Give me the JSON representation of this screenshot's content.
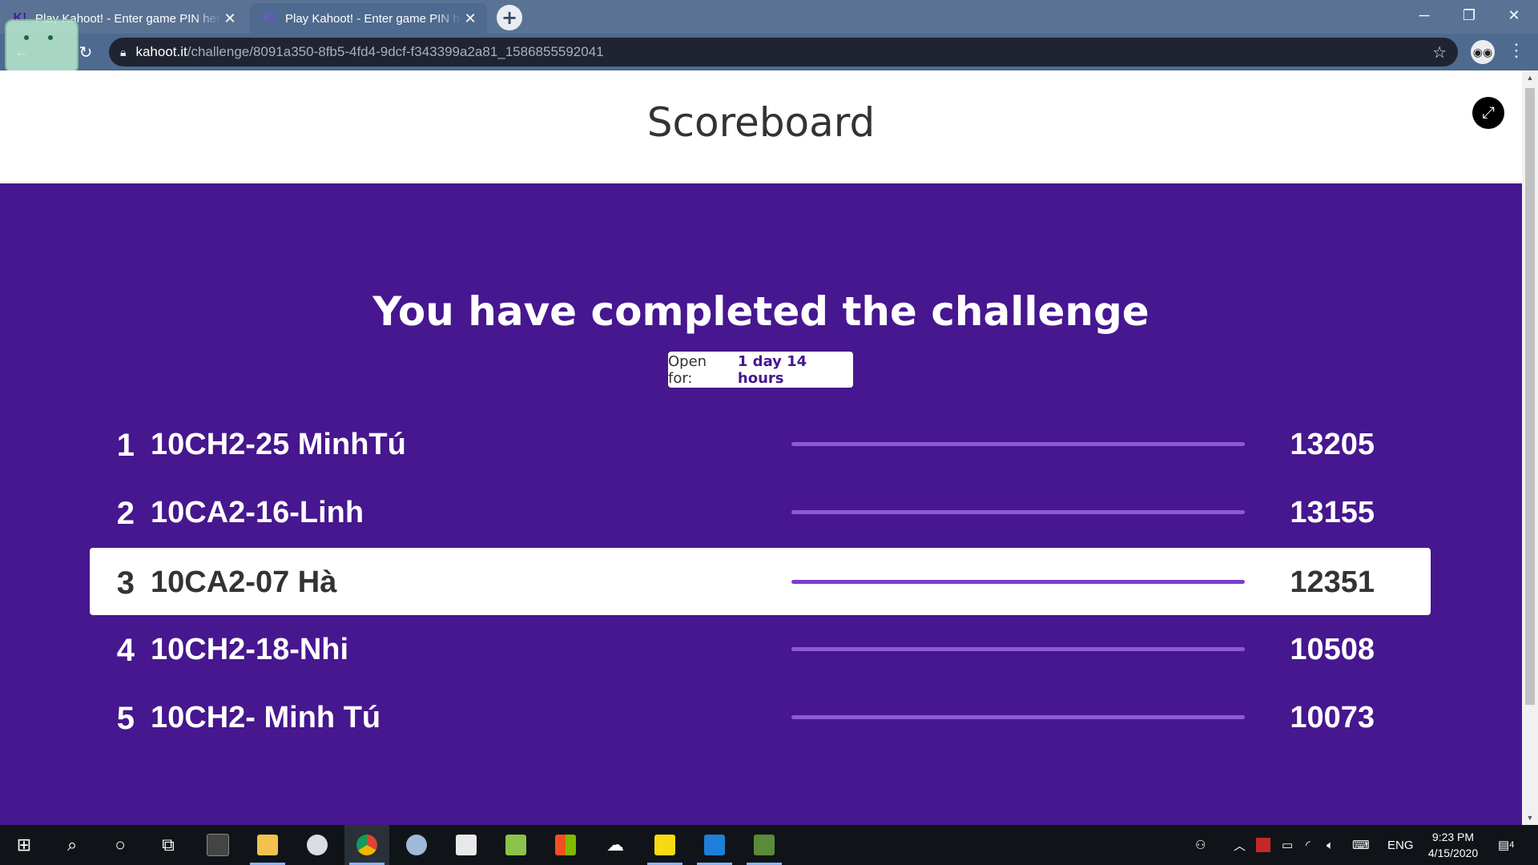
{
  "browser": {
    "tabs": [
      {
        "title": "Play Kahoot! - Enter game PIN here!",
        "favicon": "K!",
        "active": false
      },
      {
        "title": "Play Kahoot! - Enter game PIN here!",
        "favicon": "K!",
        "active": true
      }
    ],
    "address": {
      "host": "kahoot.it",
      "path": "/challenge/8091a350-8fb5-4fd4-9dcf-f343399a2a81_1586855592041"
    }
  },
  "page": {
    "title": "Scoreboard",
    "headline": "You have completed the challenge",
    "open_for_label": "Open for:",
    "open_for_value": "1 day 14 hours"
  },
  "scoreboard": [
    {
      "rank": "1",
      "name": "10CH2-25 MinhTú",
      "score": "13205",
      "bar_fraction": 1.0,
      "highlighted": false
    },
    {
      "rank": "2",
      "name": "10CA2-16-Linh",
      "score": "13155",
      "bar_fraction": 1.0,
      "highlighted": false
    },
    {
      "rank": "3",
      "name": "10CA2-07 Hà",
      "score": "12351",
      "bar_fraction": 1.0,
      "highlighted": true
    },
    {
      "rank": "4",
      "name": "10CH2-18-Nhi",
      "score": "10508",
      "bar_fraction": 1.0,
      "highlighted": false
    },
    {
      "rank": "5",
      "name": "10CH2- Minh Tú",
      "score": "10073",
      "bar_fraction": 1.0,
      "highlighted": false
    }
  ],
  "taskbar": {
    "apps": [
      "start-icon",
      "search-icon",
      "cortana-icon",
      "task-view-icon",
      "calculator-icon",
      "file-explorer-icon",
      "paint-icon",
      "chrome-icon",
      "snipping-icon",
      "app-icon",
      "app-icon",
      "store-icon",
      "onedrive-icon",
      "sticky-notes-icon",
      "photos-icon",
      "minecraft-icon"
    ],
    "tray_language": "ENG",
    "time": "9:23 PM",
    "date": "4/15/2020",
    "notifications": "4"
  },
  "colors": {
    "kahoot_purple": "#46178f",
    "bar": "#8e59d6",
    "chrome_frame": "#5a7394"
  }
}
